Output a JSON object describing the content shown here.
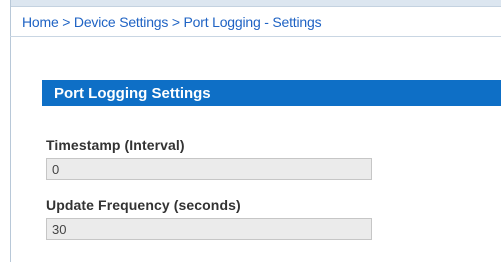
{
  "breadcrumb": {
    "home": "Home",
    "separator_1": " > ",
    "device_settings": "Device Settings",
    "separator_2": " > ",
    "current": "Port Logging - Settings"
  },
  "panel": {
    "title": "Port Logging Settings"
  },
  "fields": [
    {
      "label": "Timestamp (Interval)",
      "value": "0"
    },
    {
      "label": "Update Frequency (seconds)",
      "value": "30"
    }
  ]
}
